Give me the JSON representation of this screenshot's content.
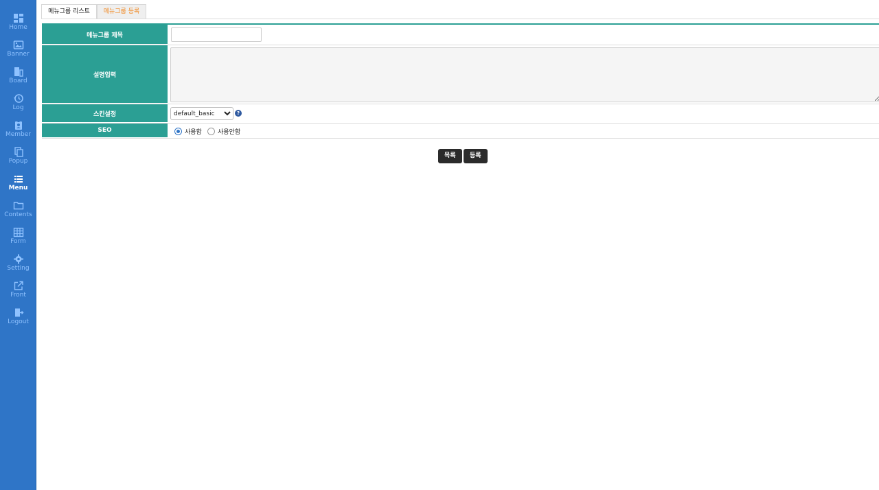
{
  "sidebar": {
    "color": "#2f75c7",
    "items": [
      {
        "label": "Home",
        "icon": "dashboard-icon"
      },
      {
        "label": "Banner",
        "icon": "image-icon"
      },
      {
        "label": "Board",
        "icon": "board-icon"
      },
      {
        "label": "Log",
        "icon": "history-icon"
      },
      {
        "label": "Member",
        "icon": "member-badge-icon"
      },
      {
        "label": "Popup",
        "icon": "copy-icon"
      },
      {
        "label": "Menu",
        "icon": "list-icon"
      },
      {
        "label": "Contents",
        "icon": "folder-icon"
      },
      {
        "label": "Form",
        "icon": "table-icon"
      },
      {
        "label": "Setting",
        "icon": "gear-icon"
      },
      {
        "label": "Front",
        "icon": "external-link-icon"
      },
      {
        "label": "Logout",
        "icon": "logout-icon"
      }
    ],
    "active": "Menu"
  },
  "tabs": [
    {
      "label": "메뉴그룹 리스트"
    },
    {
      "label": "메뉴그룹 등록"
    }
  ],
  "form": {
    "title_label": "메뉴그룹 제목",
    "title_value": "",
    "desc_label": "설명입력",
    "desc_value": "",
    "skin_label": "스킨설정",
    "skin_selected": "default_basic",
    "seo_label": "SEO",
    "seo_options": [
      "사용함",
      "사용안함"
    ],
    "seo_selected": "사용함",
    "accent": "#2b9f94"
  },
  "buttons": {
    "list": "목록",
    "submit": "등록"
  }
}
